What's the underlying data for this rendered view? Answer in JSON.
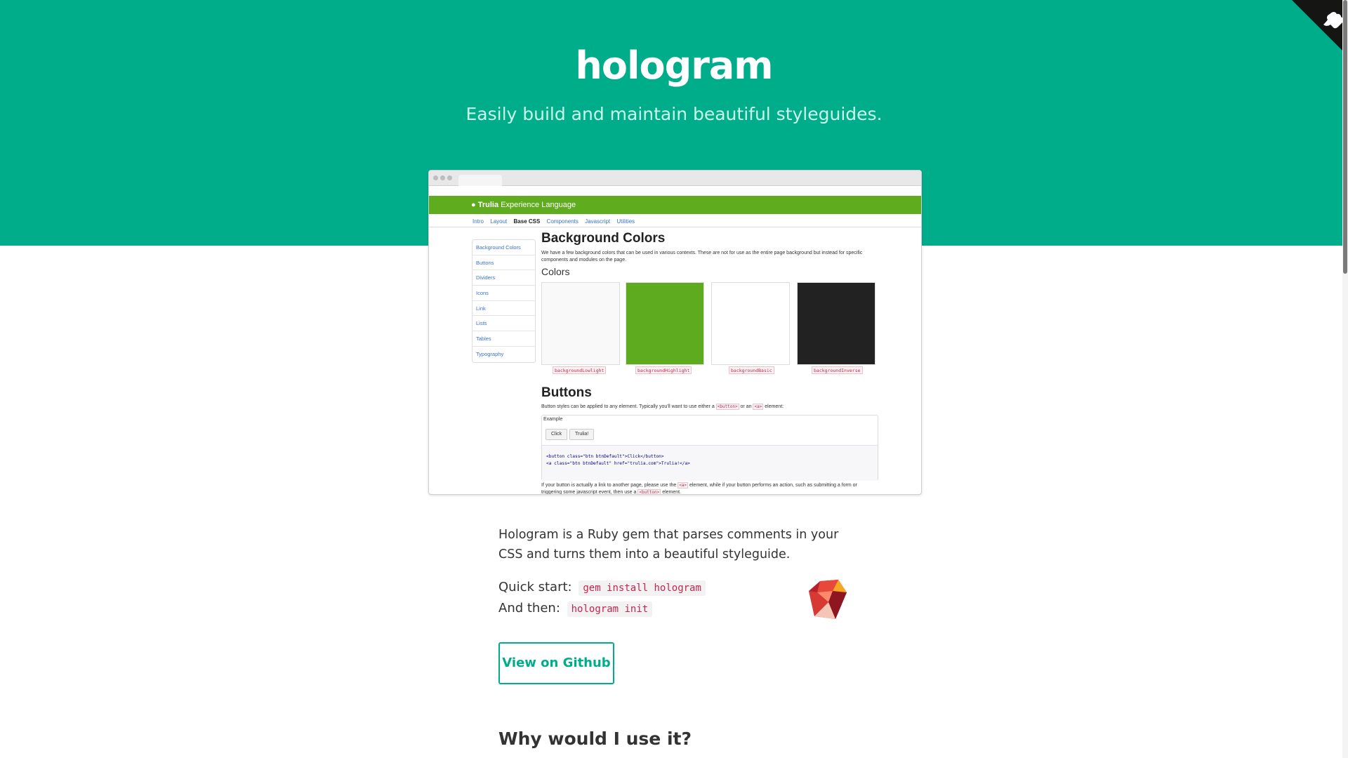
{
  "hero": {
    "title": "hologram",
    "subtitle": "Easily build and maintain beautiful styleguides."
  },
  "preview": {
    "brand_bold": "Trulia",
    "brand_rest": " Experience Language",
    "nav": [
      "Intro",
      "Layout",
      "Base CSS",
      "Components",
      "Javascript",
      "Utilities"
    ],
    "nav_active": "Base CSS",
    "sidebar": [
      "Background Colors",
      "Buttons",
      "Dividers",
      "Icons",
      "Link",
      "Lists",
      "Tables",
      "Typography"
    ],
    "section1_title": "Background Colors",
    "section1_text": "We have a few background colors that can be used in various contexts. These are not for use as the entire page background but instead for specific components and modules on the page.",
    "colors_title": "Colors",
    "swatches": [
      {
        "label": "backgroundLowlight",
        "color": "#f9f9f9"
      },
      {
        "label": "backgroundHighlight",
        "color": "#5eab1f"
      },
      {
        "label": "backgroundBasic",
        "color": "#ffffff"
      },
      {
        "label": "backgroundInverse",
        "color": "#222222"
      }
    ],
    "section2_title": "Buttons",
    "section2_text_a": "Button styles can be applied to any element. Typically you'll want to use either a ",
    "section2_code_a": "<button>",
    "section2_text_b": " or an ",
    "section2_code_b": "<a>",
    "section2_text_c": " element:",
    "example_label": "Example",
    "example_buttons": [
      "Click",
      "Trulia!"
    ],
    "code_line_1": "<button class=\"btn btnDefault\">Click</button>",
    "code_line_2": "<a class=\"btn btnDefault\" href=\"trulia.com\">Trulia!</a>",
    "section3_text_a": "If your button is actually a link to another page, please use the ",
    "section3_code_a": "<a>",
    "section3_text_b": " element, while if your button performs an action, such as submitting a form or triggering some javascript event, then use a ",
    "section3_code_b": "<button>",
    "section3_text_c": " element."
  },
  "content": {
    "lead": "Hologram is a Ruby gem that parses comments in your CSS and turns them into a beautiful styleguide.",
    "quick_start_label": "Quick start:",
    "quick_start_code": "gem install hologram",
    "and_then_label": "And then:",
    "and_then_code": "hologram init",
    "github_button": "View on Github",
    "why_heading": "Why would I use it?"
  },
  "colors": {
    "brand": "#00ad8b",
    "preview_bar": "#5fad1f"
  }
}
